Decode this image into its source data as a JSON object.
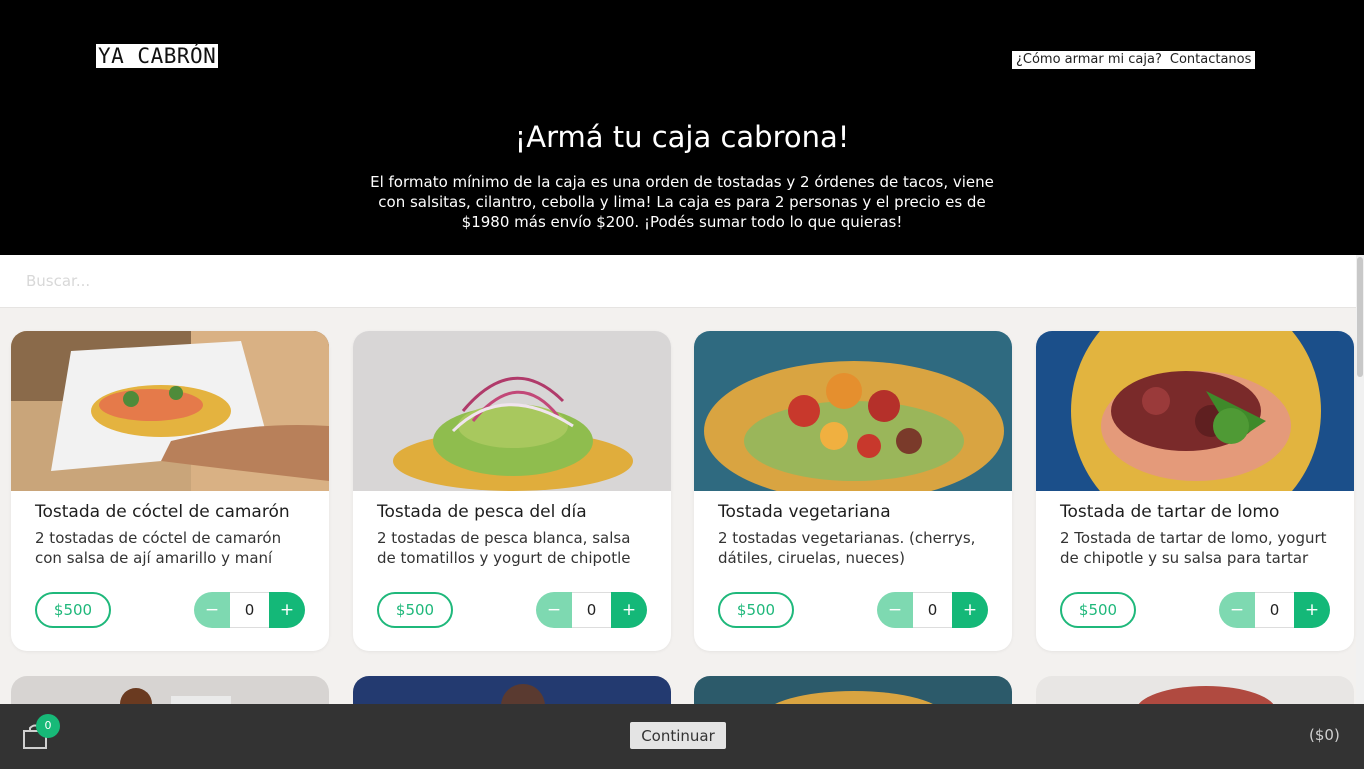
{
  "brand": {
    "logo": "YA CABRÓN"
  },
  "nav": {
    "how": "¿Cómo armar mi caja?",
    "contact": "Contactanos"
  },
  "hero": {
    "title": "¡Armá tu caja cabrona!",
    "text": "El formato mínimo de la caja es una orden de tostadas y 2 órdenes de tacos, viene con salsitas, cilantro, cebolla y lima! La caja es para 2 personas y el precio es de $1980 más envío $200. ¡Podés sumar todo lo que quieras!"
  },
  "search": {
    "placeholder": "Buscar...",
    "value": ""
  },
  "products": [
    {
      "title": "Tostada de cóctel de camarón",
      "desc": "2 tostadas de cóctel de camarón con salsa de ají amarillo y maní",
      "price": "$500",
      "qty": "0",
      "minus": "−",
      "plus": "+"
    },
    {
      "title": "Tostada de pesca del día",
      "desc": "2 tostadas de pesca blanca, salsa de tomatillos y yogurt de chipotle",
      "price": "$500",
      "qty": "0",
      "minus": "−",
      "plus": "+"
    },
    {
      "title": "Tostada vegetariana",
      "desc": "2 tostadas vegetarianas. (cherrys, dátiles, ciruelas, nueces)",
      "price": "$500",
      "qty": "0",
      "minus": "−",
      "plus": "+"
    },
    {
      "title": "Tostada de tartar de lomo",
      "desc": "2 Tostada de tartar de lomo, yogurt de chipotle y su salsa para tartar",
      "price": "$500",
      "qty": "0",
      "minus": "−",
      "plus": "+"
    }
  ],
  "footer": {
    "cart_count": "0",
    "continue": "Continuar",
    "total": "($0)"
  },
  "colors": {
    "accent": "#14b878",
    "accent_light": "#7ed9b1",
    "header_bg": "#000000",
    "footer_bg": "#333333"
  }
}
